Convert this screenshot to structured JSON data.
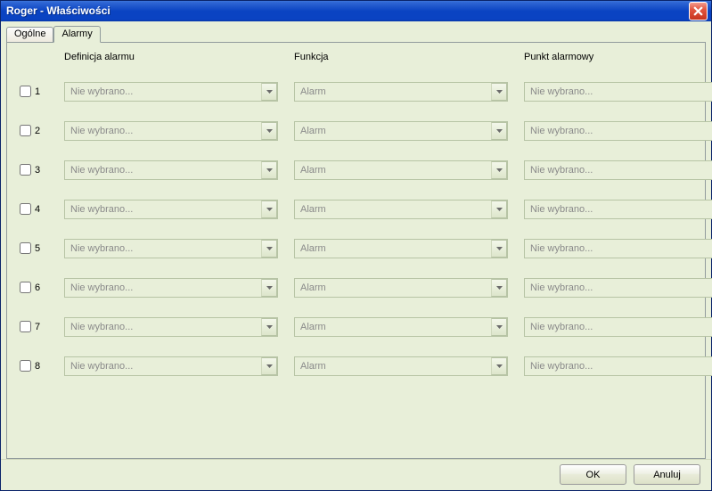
{
  "window": {
    "title": "Roger - Właściwości"
  },
  "tabs": {
    "general": "Ogólne",
    "alarms": "Alarmy"
  },
  "headers": {
    "definition": "Definicja alarmu",
    "function": "Funkcja",
    "point": "Punkt alarmowy"
  },
  "combo_values": {
    "not_selected": "Nie wybrano...",
    "alarm": "Alarm"
  },
  "rows": [
    {
      "num": "1",
      "def": "Nie wybrano...",
      "func": "Alarm",
      "point": "Nie wybrano..."
    },
    {
      "num": "2",
      "def": "Nie wybrano...",
      "func": "Alarm",
      "point": "Nie wybrano..."
    },
    {
      "num": "3",
      "def": "Nie wybrano...",
      "func": "Alarm",
      "point": "Nie wybrano..."
    },
    {
      "num": "4",
      "def": "Nie wybrano...",
      "func": "Alarm",
      "point": "Nie wybrano..."
    },
    {
      "num": "5",
      "def": "Nie wybrano...",
      "func": "Alarm",
      "point": "Nie wybrano..."
    },
    {
      "num": "6",
      "def": "Nie wybrano...",
      "func": "Alarm",
      "point": "Nie wybrano..."
    },
    {
      "num": "7",
      "def": "Nie wybrano...",
      "func": "Alarm",
      "point": "Nie wybrano..."
    },
    {
      "num": "8",
      "def": "Nie wybrano...",
      "func": "Alarm",
      "point": "Nie wybrano..."
    }
  ],
  "footer": {
    "ok": "OK",
    "cancel": "Anuluj"
  }
}
